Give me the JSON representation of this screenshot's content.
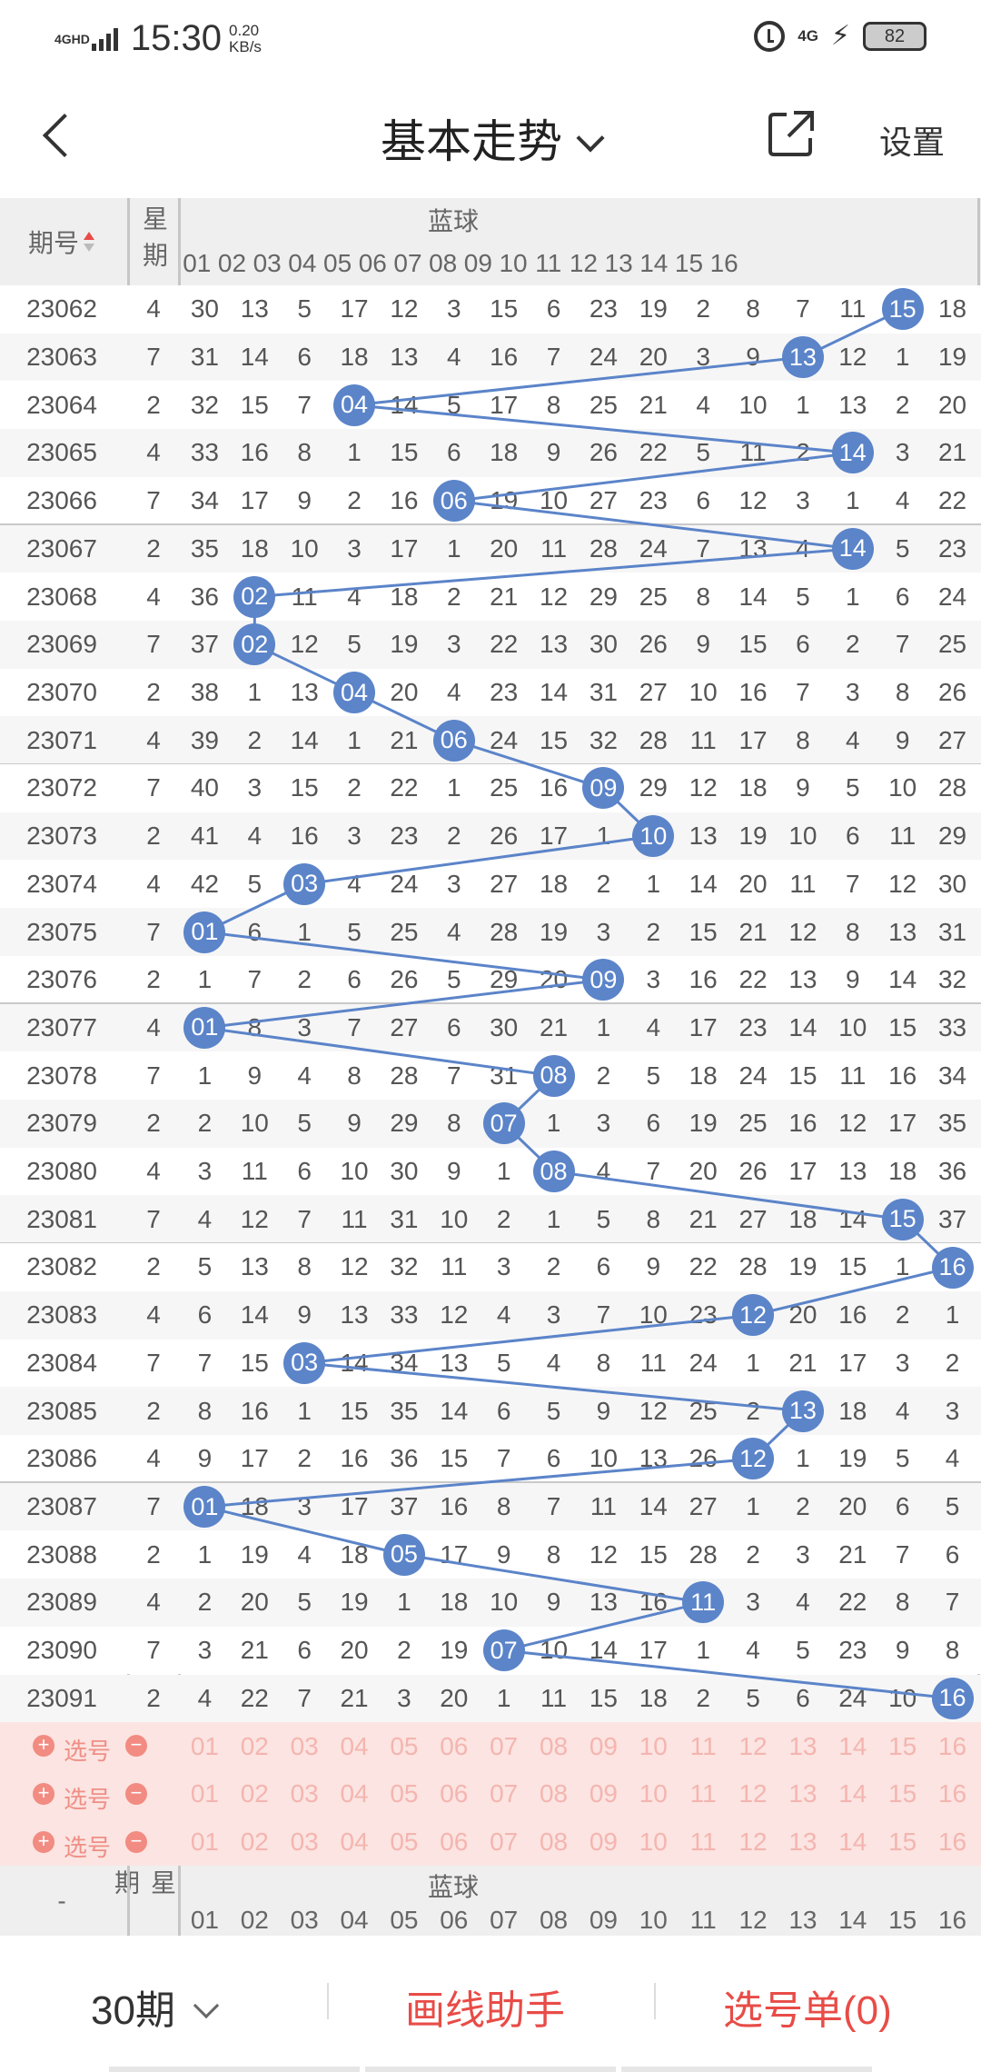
{
  "status_bar": {
    "network": "4GHD",
    "time": "15:30",
    "speed_value": "0.20",
    "speed_unit": "KB/s",
    "network_right": "4G",
    "battery": "82"
  },
  "nav": {
    "title": "基本走势",
    "settings_label": "设置"
  },
  "table": {
    "period_header": "期号",
    "week_header": "星期",
    "blue_header": "蓝球",
    "columns": [
      "01",
      "02",
      "03",
      "04",
      "05",
      "06",
      "07",
      "08",
      "09",
      "10",
      "11",
      "12",
      "13",
      "14",
      "15",
      "16"
    ],
    "rows": [
      {
        "period": "23062",
        "week": "4",
        "values": [
          "30",
          "13",
          "5",
          "17",
          "12",
          "3",
          "15",
          "6",
          "23",
          "19",
          "2",
          "8",
          "7",
          "11",
          "15",
          "18"
        ],
        "hit": 15
      },
      {
        "period": "23063",
        "week": "7",
        "values": [
          "31",
          "14",
          "6",
          "18",
          "13",
          "4",
          "16",
          "7",
          "24",
          "20",
          "3",
          "9",
          "13",
          "12",
          "1",
          "19"
        ],
        "hit": 13
      },
      {
        "period": "23064",
        "week": "2",
        "values": [
          "32",
          "15",
          "7",
          "04",
          "14",
          "5",
          "17",
          "8",
          "25",
          "21",
          "4",
          "10",
          "1",
          "13",
          "2",
          "20"
        ],
        "hit": 4
      },
      {
        "period": "23065",
        "week": "4",
        "values": [
          "33",
          "16",
          "8",
          "1",
          "15",
          "6",
          "18",
          "9",
          "26",
          "22",
          "5",
          "11",
          "2",
          "14",
          "3",
          "21"
        ],
        "hit": 14
      },
      {
        "period": "23066",
        "week": "7",
        "values": [
          "34",
          "17",
          "9",
          "2",
          "16",
          "06",
          "19",
          "10",
          "27",
          "23",
          "6",
          "12",
          "3",
          "1",
          "4",
          "22"
        ],
        "hit": 6
      },
      {
        "period": "23067",
        "week": "2",
        "values": [
          "35",
          "18",
          "10",
          "3",
          "17",
          "1",
          "20",
          "11",
          "28",
          "24",
          "7",
          "13",
          "4",
          "14",
          "5",
          "23"
        ],
        "hit": 14
      },
      {
        "period": "23068",
        "week": "4",
        "values": [
          "36",
          "02",
          "11",
          "4",
          "18",
          "2",
          "21",
          "12",
          "29",
          "25",
          "8",
          "14",
          "5",
          "1",
          "6",
          "24"
        ],
        "hit": 2
      },
      {
        "period": "23069",
        "week": "7",
        "values": [
          "37",
          "02",
          "12",
          "5",
          "19",
          "3",
          "22",
          "13",
          "30",
          "26",
          "9",
          "15",
          "6",
          "2",
          "7",
          "25"
        ],
        "hit": 2
      },
      {
        "period": "23070",
        "week": "2",
        "values": [
          "38",
          "1",
          "13",
          "04",
          "20",
          "4",
          "23",
          "14",
          "31",
          "27",
          "10",
          "16",
          "7",
          "3",
          "8",
          "26"
        ],
        "hit": 4
      },
      {
        "period": "23071",
        "week": "4",
        "values": [
          "39",
          "2",
          "14",
          "1",
          "21",
          "06",
          "24",
          "15",
          "32",
          "28",
          "11",
          "17",
          "8",
          "4",
          "9",
          "27"
        ],
        "hit": 6
      },
      {
        "period": "23072",
        "week": "7",
        "values": [
          "40",
          "3",
          "15",
          "2",
          "22",
          "1",
          "25",
          "16",
          "09",
          "29",
          "12",
          "18",
          "9",
          "5",
          "10",
          "28"
        ],
        "hit": 9
      },
      {
        "period": "23073",
        "week": "2",
        "values": [
          "41",
          "4",
          "16",
          "3",
          "23",
          "2",
          "26",
          "17",
          "1",
          "10",
          "13",
          "19",
          "10",
          "6",
          "11",
          "29"
        ],
        "hit": 10
      },
      {
        "period": "23074",
        "week": "4",
        "values": [
          "42",
          "5",
          "03",
          "4",
          "24",
          "3",
          "27",
          "18",
          "2",
          "1",
          "14",
          "20",
          "11",
          "7",
          "12",
          "30"
        ],
        "hit": 3
      },
      {
        "period": "23075",
        "week": "7",
        "values": [
          "01",
          "6",
          "1",
          "5",
          "25",
          "4",
          "28",
          "19",
          "3",
          "2",
          "15",
          "21",
          "12",
          "8",
          "13",
          "31"
        ],
        "hit": 1
      },
      {
        "period": "23076",
        "week": "2",
        "values": [
          "1",
          "7",
          "2",
          "6",
          "26",
          "5",
          "29",
          "20",
          "09",
          "3",
          "16",
          "22",
          "13",
          "9",
          "14",
          "32"
        ],
        "hit": 9
      },
      {
        "period": "23077",
        "week": "4",
        "values": [
          "01",
          "8",
          "3",
          "7",
          "27",
          "6",
          "30",
          "21",
          "1",
          "4",
          "17",
          "23",
          "14",
          "10",
          "15",
          "33"
        ],
        "hit": 1
      },
      {
        "period": "23078",
        "week": "7",
        "values": [
          "1",
          "9",
          "4",
          "8",
          "28",
          "7",
          "31",
          "08",
          "2",
          "5",
          "18",
          "24",
          "15",
          "11",
          "16",
          "34"
        ],
        "hit": 8
      },
      {
        "period": "23079",
        "week": "2",
        "values": [
          "2",
          "10",
          "5",
          "9",
          "29",
          "8",
          "07",
          "1",
          "3",
          "6",
          "19",
          "25",
          "16",
          "12",
          "17",
          "35"
        ],
        "hit": 7
      },
      {
        "period": "23080",
        "week": "4",
        "values": [
          "3",
          "11",
          "6",
          "10",
          "30",
          "9",
          "1",
          "08",
          "4",
          "7",
          "20",
          "26",
          "17",
          "13",
          "18",
          "36"
        ],
        "hit": 8
      },
      {
        "period": "23081",
        "week": "7",
        "values": [
          "4",
          "12",
          "7",
          "11",
          "31",
          "10",
          "2",
          "1",
          "5",
          "8",
          "21",
          "27",
          "18",
          "14",
          "15",
          "37"
        ],
        "hit": 15
      },
      {
        "period": "23082",
        "week": "2",
        "values": [
          "5",
          "13",
          "8",
          "12",
          "32",
          "11",
          "3",
          "2",
          "6",
          "9",
          "22",
          "28",
          "19",
          "15",
          "1",
          "16"
        ],
        "hit": 16
      },
      {
        "period": "23083",
        "week": "4",
        "values": [
          "6",
          "14",
          "9",
          "13",
          "33",
          "12",
          "4",
          "3",
          "7",
          "10",
          "23",
          "12",
          "20",
          "16",
          "2",
          "1"
        ],
        "hit": 12
      },
      {
        "period": "23084",
        "week": "7",
        "values": [
          "7",
          "15",
          "03",
          "14",
          "34",
          "13",
          "5",
          "4",
          "8",
          "11",
          "24",
          "1",
          "21",
          "17",
          "3",
          "2"
        ],
        "hit": 3
      },
      {
        "period": "23085",
        "week": "2",
        "values": [
          "8",
          "16",
          "1",
          "15",
          "35",
          "14",
          "6",
          "5",
          "9",
          "12",
          "25",
          "2",
          "13",
          "18",
          "4",
          "3"
        ],
        "hit": 13
      },
      {
        "period": "23086",
        "week": "4",
        "values": [
          "9",
          "17",
          "2",
          "16",
          "36",
          "15",
          "7",
          "6",
          "10",
          "13",
          "26",
          "12",
          "1",
          "19",
          "5",
          "4"
        ],
        "hit": 12
      },
      {
        "period": "23087",
        "week": "7",
        "values": [
          "01",
          "18",
          "3",
          "17",
          "37",
          "16",
          "8",
          "7",
          "11",
          "14",
          "27",
          "1",
          "2",
          "20",
          "6",
          "5"
        ],
        "hit": 1
      },
      {
        "period": "23088",
        "week": "2",
        "values": [
          "1",
          "19",
          "4",
          "18",
          "05",
          "17",
          "9",
          "8",
          "12",
          "15",
          "28",
          "2",
          "3",
          "21",
          "7",
          "6"
        ],
        "hit": 5
      },
      {
        "period": "23089",
        "week": "4",
        "values": [
          "2",
          "20",
          "5",
          "19",
          "1",
          "18",
          "10",
          "9",
          "13",
          "16",
          "11",
          "3",
          "4",
          "22",
          "8",
          "7"
        ],
        "hit": 11
      },
      {
        "period": "23090",
        "week": "7",
        "values": [
          "3",
          "21",
          "6",
          "20",
          "2",
          "19",
          "07",
          "10",
          "14",
          "17",
          "1",
          "4",
          "5",
          "23",
          "9",
          "8"
        ],
        "hit": 7
      },
      {
        "period": "23091",
        "week": "2",
        "values": [
          "4",
          "22",
          "7",
          "21",
          "3",
          "20",
          "1",
          "11",
          "15",
          "18",
          "2",
          "5",
          "6",
          "24",
          "10",
          "16"
        ],
        "hit": 16
      }
    ],
    "select_rows": [
      {
        "label": "选号"
      },
      {
        "label": "选号"
      },
      {
        "label": "选号"
      }
    ],
    "footer_period": "-",
    "footer_week": "星期",
    "footer_blue": "蓝球"
  },
  "bottom": {
    "periods_label": "30期",
    "draw_helper_label": "画线助手",
    "selection_label": "选号单(0)"
  },
  "colors": {
    "ball": "#5b84c9",
    "accent_red": "#e84c47",
    "select_bg": "#fbe4e1"
  }
}
